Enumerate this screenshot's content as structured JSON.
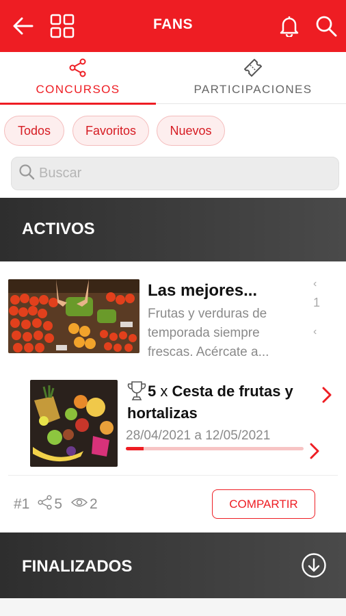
{
  "header": {
    "title": "FANS",
    "brand_color": "#ee1d23",
    "icons": [
      "back-arrow-icon",
      "grid-icon",
      "bell-icon",
      "search-icon"
    ]
  },
  "tabs": [
    {
      "label": "CONCURSOS",
      "icon": "share-icon",
      "active": true
    },
    {
      "label": "PARTICIPACIONES",
      "icon": "ticket-icon",
      "active": false
    }
  ],
  "filters": [
    "Todos",
    "Favoritos",
    "Nuevos"
  ],
  "search": {
    "placeholder": "Buscar"
  },
  "sections": {
    "active_label": "ACTIVOS",
    "finished_label": "FINALIZADOS"
  },
  "contest": {
    "title": "Las mejores...",
    "description": "Frutas y verduras de temporada siempre frescas. Acércate a...",
    "side_glyphs": [
      "‹",
      "1",
      "‹"
    ],
    "prize": {
      "quantity": "5",
      "times": "x",
      "name": "Cesta de frutas y hortalizas",
      "dates": "28/04/2021 a 12/05/2021",
      "progress": 0.1
    },
    "stats": {
      "rank": "#1",
      "shares": "5",
      "views": "2"
    },
    "share_label": "COMPARTIR"
  }
}
